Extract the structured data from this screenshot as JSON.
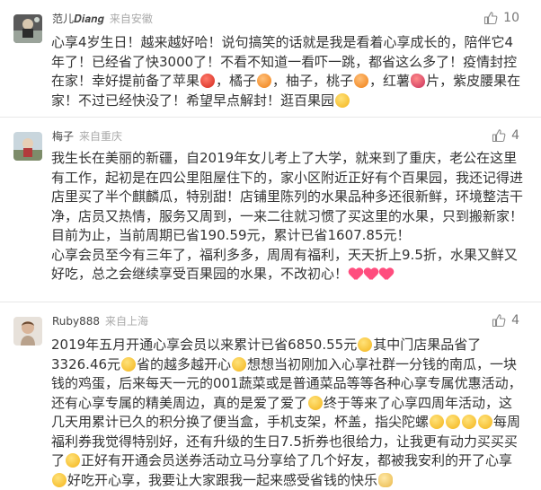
{
  "comments": [
    {
      "user": "范儿𝑫𝒊𝒂𝒏𝒈",
      "location": "来自安徽",
      "likes": "10",
      "text": [
        "心享4岁生日！越来越好哈！说句搞笑的话就是我是看着心享成长的，陪伴它4年了！已经省了快3000了！不看不知道一看吓一跳，都省这么多了！疫情封控在家！幸好提前备了苹果",
        "，橘子",
        "，柚子，桃子",
        "，红薯",
        "片，紫皮腰果在家！不过已经快没了！希望早点解封！逛百果园"
      ]
    },
    {
      "user": "梅子",
      "location": "来自重庆",
      "likes": "4",
      "text_main": "我生长在美丽的新疆，自2019年女儿考上了大学，就来到了重庆，老公在这里有工作，起初是在四公里阻屋住下的，家小区附近正好有个百果园，我还记得进店里买了半个麒麟瓜，特别甜！店铺里陈列的水果品种多还很新鲜，环境整洁干净，店员又热情，服务又周到，一来二往就习惯了买这里的水果，只到搬新家！",
      "text_stats": "目前为止，当前周期已省190.59元，累计已省1607.85元！",
      "text_end": "心享会员至今有三年了，福利多多，周周有福利，天天折上9.5折，水果又鲜又好吃，总之会继续享受百果园的水果，不改初心！"
    },
    {
      "user": "Ruby888",
      "location": "来自上海",
      "likes": "4",
      "text": [
        "2019年五月开通心享会员以来累计已省6850.55元",
        "其中门店果品省了3326.46元",
        "省的越多越开心",
        "想想当初刚加入心享社群一分钱的南瓜，一块钱的鸡蛋，后来每天一元的001蔬菜或是普通菜品等等各种心享专属优惠活动，还有心享专属的精美周边，真的是爱了爱了",
        "终于等来了心享四周年活动，这几天用累计已久的积分换了便当盒，手机支架，杯盖，指尖陀螺",
        "每周福利券我觉得特别好，还有升级的生日7.5折券也很给力，让我更有动力买买买了",
        "正好有开通会员送券活动立马分享给了几个好友，都被我安利的开了心享",
        "好吃开心享，我要让大家跟我一起来感受省钱的快乐"
      ]
    }
  ]
}
